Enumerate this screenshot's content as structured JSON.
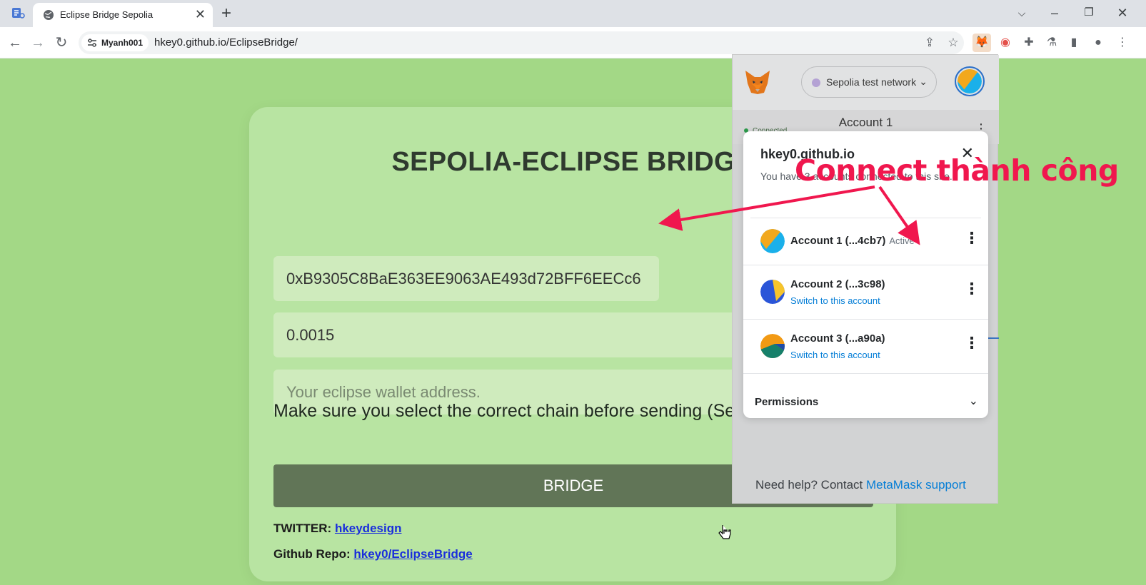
{
  "browser": {
    "tab_title": "Eclipse Bridge Sepolia",
    "tab_close": "✕",
    "new_tab": "+",
    "site_chip": "Myanh001",
    "url": "hkey0.github.io/EclipseBridge/"
  },
  "page": {
    "title": "SEPOLIA-ECLIPSE BRIDGE",
    "address_value": "0xB9305C8BaE363EE9063AE493d72BFF6EECc6",
    "amount_value": "0.0015",
    "eclipse_placeholder": "Your eclipse wallet address.",
    "note": "Make sure you select the correct chain before sending (Sepolia Testnet).",
    "bridge_button": "BRIDGE",
    "twitter_label": "TWITTER:",
    "twitter_link": "hkeydesign",
    "github_label": "Github Repo:",
    "github_link": "hkey0/EclipseBridge"
  },
  "metamask": {
    "network": "Sepolia test network",
    "bg_connected": "Connected",
    "bg_account": "Account 1",
    "modal_title": "hkey0.github.io",
    "modal_desc": "You have 3 accounts connected to this site.",
    "accounts": [
      {
        "name": "Account 1 (...4cb7)",
        "status": "Active",
        "switch": ""
      },
      {
        "name": "Account 2 (...3c98)",
        "status": "",
        "switch": "Switch to this account"
      },
      {
        "name": "Account 3 (...a90a)",
        "status": "",
        "switch": "Switch to this account"
      }
    ],
    "permissions": "Permissions",
    "help_text": "Need help? Contact ",
    "help_link": "MetaMask support"
  },
  "annotation": {
    "text": "Connect thành công",
    "color": "#f0174e"
  },
  "colors": {
    "page_bg": "#a3d886",
    "card_bg": "#b8e4a2",
    "button_bg": "#617557",
    "link": "#037dd6"
  }
}
